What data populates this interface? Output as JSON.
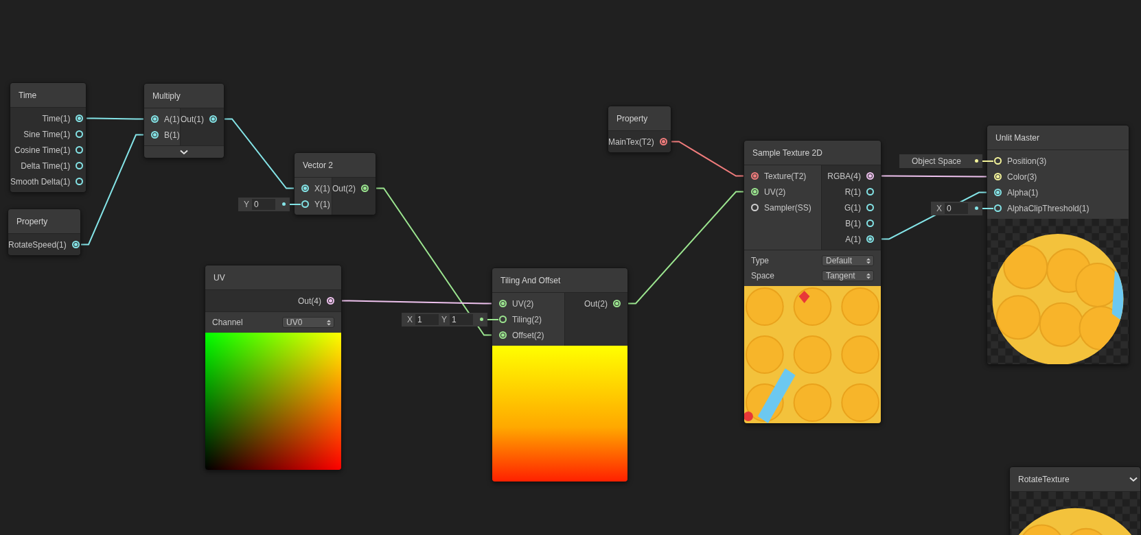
{
  "nodes": [
    {
      "title": "Time",
      "outputs": [
        {
          "label": "Time(1)",
          "color": "#84e4e7",
          "connected": true
        },
        {
          "label": "Sine Time(1)",
          "color": "#84e4e7",
          "connected": false
        },
        {
          "label": "Cosine Time(1)",
          "color": "#84e4e7",
          "connected": false
        },
        {
          "label": "Delta Time(1)",
          "color": "#84e4e7",
          "connected": false
        },
        {
          "label": "Smooth Delta(1)",
          "color": "#84e4e7",
          "connected": false
        }
      ]
    },
    {
      "title": "Multiply",
      "inputs": [
        {
          "label": "A(1)",
          "color": "#84e4e7",
          "connected": true
        },
        {
          "label": "B(1)",
          "color": "#84e4e7",
          "connected": true
        }
      ],
      "outputs": [
        {
          "label": "Out(1)",
          "color": "#84e4e7",
          "connected": true
        }
      ],
      "footer_chevron": true
    },
    {
      "title": "Property",
      "outputs": [
        {
          "label": "RotateSpeed(1)",
          "color": "#84e4e7",
          "connected": true
        }
      ]
    },
    {
      "title": "Vector 2",
      "inputs": [
        {
          "label": "X(1)",
          "color": "#84e4e7",
          "connected": true
        },
        {
          "label": "Y(1)",
          "color": "#84e4e7",
          "connected": false,
          "default": [
            {
              "axis": "Y",
              "value": "0"
            }
          ]
        }
      ],
      "outputs": [
        {
          "label": "Out(2)",
          "color": "#9be58f",
          "connected": true
        }
      ]
    },
    {
      "title": "UV",
      "outputs": [
        {
          "label": "Out(4)",
          "color": "#eec2ee",
          "connected": true
        }
      ],
      "settings": [
        {
          "label": "Channel",
          "value": "UV0"
        }
      ],
      "preview": {
        "kind": "uv"
      }
    },
    {
      "title": "Tiling And Offset",
      "inputs": [
        {
          "label": "UV(2)",
          "color": "#9be58f",
          "connected": true
        },
        {
          "label": "Tiling(2)",
          "color": "#9be58f",
          "connected": false,
          "default": [
            {
              "axis": "X",
              "value": "1"
            },
            {
              "axis": "Y",
              "value": "1"
            }
          ]
        },
        {
          "label": "Offset(2)",
          "color": "#9be58f",
          "connected": true
        }
      ],
      "outputs": [
        {
          "label": "Out(2)",
          "color": "#9be58f",
          "connected": true
        }
      ],
      "preview": {
        "kind": "gradient"
      }
    },
    {
      "title": "Property",
      "outputs": [
        {
          "label": "MainTex(T2)",
          "color": "#f07c7c",
          "connected": true
        }
      ]
    },
    {
      "title": "Sample Texture 2D",
      "inputs": [
        {
          "label": "Texture(T2)",
          "color": "#f07c7c",
          "connected": true
        },
        {
          "label": "UV(2)",
          "color": "#9be58f",
          "connected": true
        },
        {
          "label": "Sampler(SS)",
          "color": "#d0d0d0",
          "connected": false
        }
      ],
      "outputs": [
        {
          "label": "RGBA(4)",
          "color": "#eec2ee",
          "connected": true
        },
        {
          "label": "R(1)",
          "color": "#84e4e7",
          "connected": false
        },
        {
          "label": "G(1)",
          "color": "#84e4e7",
          "connected": false
        },
        {
          "label": "B(1)",
          "color": "#84e4e7",
          "connected": false
        },
        {
          "label": "A(1)",
          "color": "#84e4e7",
          "connected": true
        }
      ],
      "settings": [
        {
          "label": "Type",
          "value": "Default"
        },
        {
          "label": "Space",
          "value": "Tangent"
        }
      ],
      "preview": {
        "kind": "texture"
      }
    },
    {
      "title": "Unlit Master",
      "inputs": [
        {
          "label": "Position(3)",
          "color": "#f3f39a",
          "connected": false,
          "default": [
            {
              "value": "Object Space"
            }
          ]
        },
        {
          "label": "Color(3)",
          "color": "#f3f39a",
          "connected": true
        },
        {
          "label": "Alpha(1)",
          "color": "#84e4e7",
          "connected": true
        },
        {
          "label": "AlphaClipThreshold(1)",
          "color": "#84e4e7",
          "connected": false,
          "default": [
            {
              "axis": "X",
              "value": "0"
            }
          ]
        }
      ],
      "preview": {
        "kind": "sphere"
      }
    },
    {
      "title": "RotateTexture",
      "header_chevron": true,
      "preview": {
        "kind": "sphere_top"
      }
    }
  ]
}
